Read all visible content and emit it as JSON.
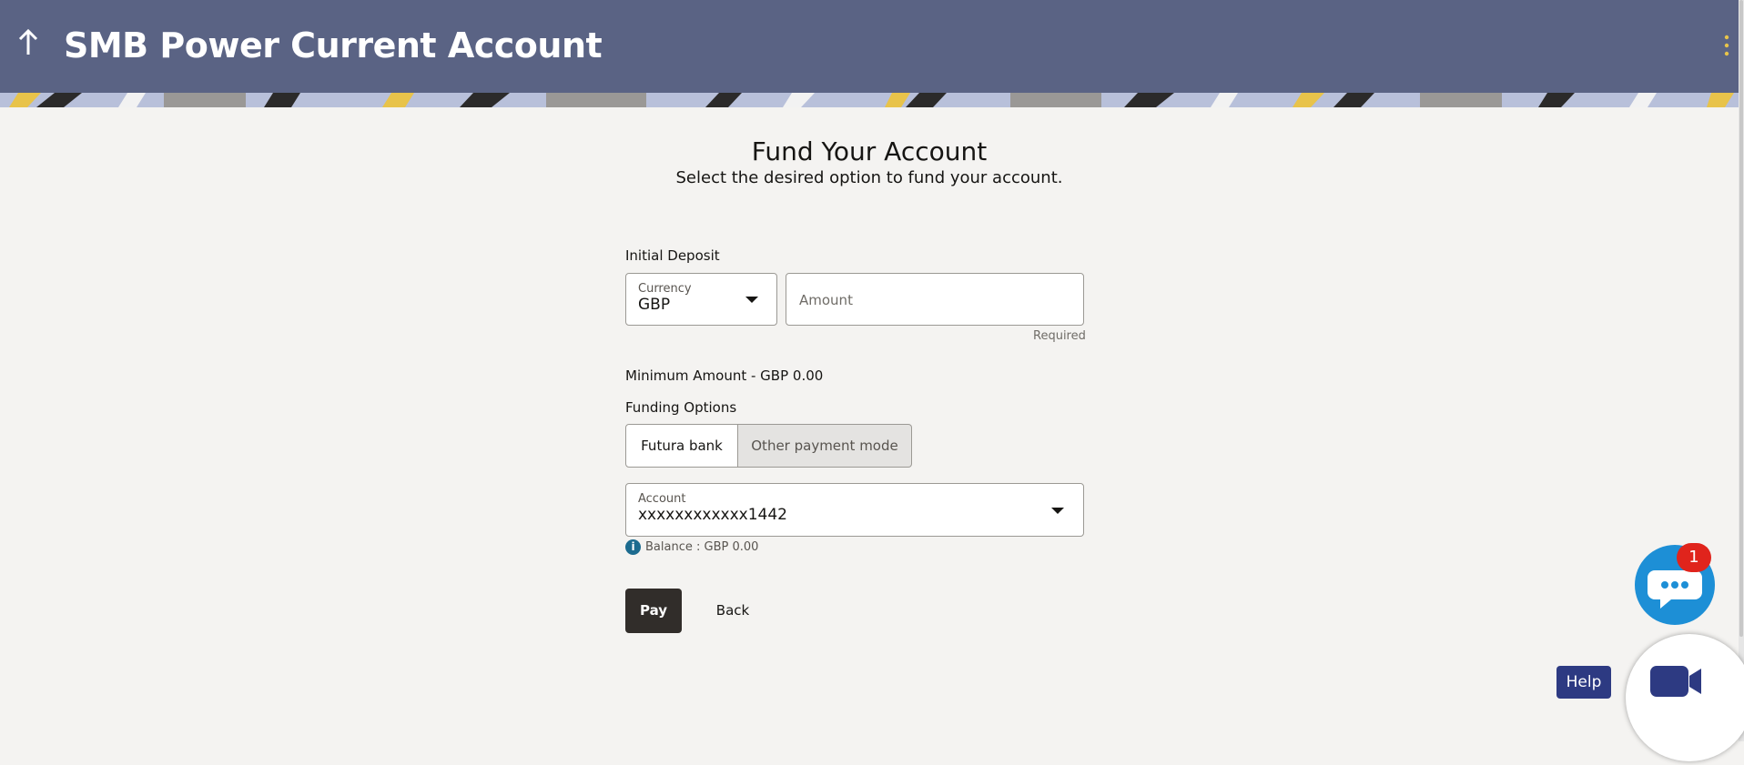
{
  "header": {
    "title": "SMB Power Current Account",
    "back_icon": "arrow-up-icon",
    "menu_icon": "kebab-menu-icon"
  },
  "page": {
    "heading": "Fund Your Account",
    "subheading": "Select the desired option to fund your account."
  },
  "initial_deposit": {
    "label": "Initial Deposit",
    "currency_label": "Currency",
    "currency_value": "GBP",
    "amount_placeholder": "Amount",
    "required_text": "Required",
    "minimum_text": "Minimum Amount - GBP 0.00"
  },
  "funding": {
    "label": "Funding Options",
    "options": [
      "Futura bank",
      "Other payment mode"
    ],
    "selected": "Futura bank",
    "account_label": "Account",
    "account_value": "xxxxxxxxxxxx1442",
    "balance_text": "Balance : GBP 0.00"
  },
  "actions": {
    "pay": "Pay",
    "back": "Back"
  },
  "widgets": {
    "chat_badge": "1",
    "help": "Help"
  },
  "colors": {
    "header": "#5a6384",
    "primary_button": "#312d2a",
    "chat": "#1d8fd6",
    "badge": "#e0241c",
    "help": "#2d3a82"
  }
}
